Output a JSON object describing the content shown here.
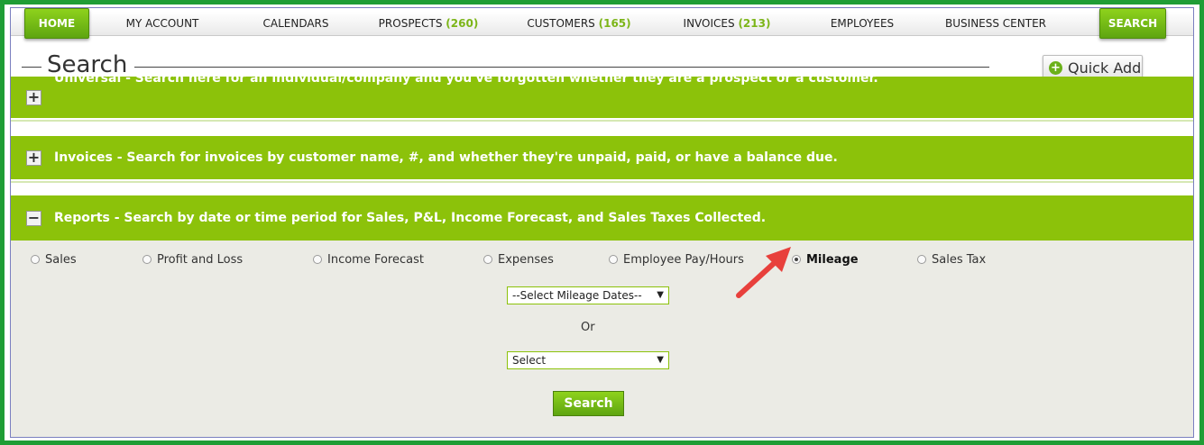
{
  "nav": {
    "home": "HOME",
    "items": [
      {
        "label": "MY ACCOUNT",
        "count": ""
      },
      {
        "label": "CALENDARS",
        "count": ""
      },
      {
        "label": "PROSPECTS",
        "count": "(260)"
      },
      {
        "label": "CUSTOMERS",
        "count": "(165)"
      },
      {
        "label": "INVOICES",
        "count": "(213)"
      },
      {
        "label": "EMPLOYEES",
        "count": ""
      },
      {
        "label": "BUSINESS CENTER",
        "count": ""
      }
    ],
    "search": "SEARCH"
  },
  "page": {
    "title": "Search",
    "quick_add": "Quick Add"
  },
  "panels": [
    {
      "label": "Universal - Search here for an individual/company and you've forgotten whether they are a prospect or a customer.",
      "expanded": false
    },
    {
      "label": "Invoices - Search for invoices by customer name, #, and whether they're unpaid, paid, or have a balance due.",
      "expanded": false
    },
    {
      "label": "Reports - Search by date or time period for Sales, P&L, Income Forecast, and Sales Taxes Collected.",
      "expanded": true
    }
  ],
  "reports": {
    "options": [
      "Sales",
      "Profit and Loss",
      "Income Forecast",
      "Expenses",
      "Employee Pay/Hours",
      "Mileage",
      "Sales Tax"
    ],
    "selected": "Mileage",
    "date_select": "--Select Mileage Dates--",
    "or_label": "Or",
    "period_select": "Select",
    "search_button": "Search"
  },
  "colors": {
    "brand_green": "#8cc20a",
    "frame_green": "#1f9d35",
    "annotation_arrow": "#e8403c"
  }
}
